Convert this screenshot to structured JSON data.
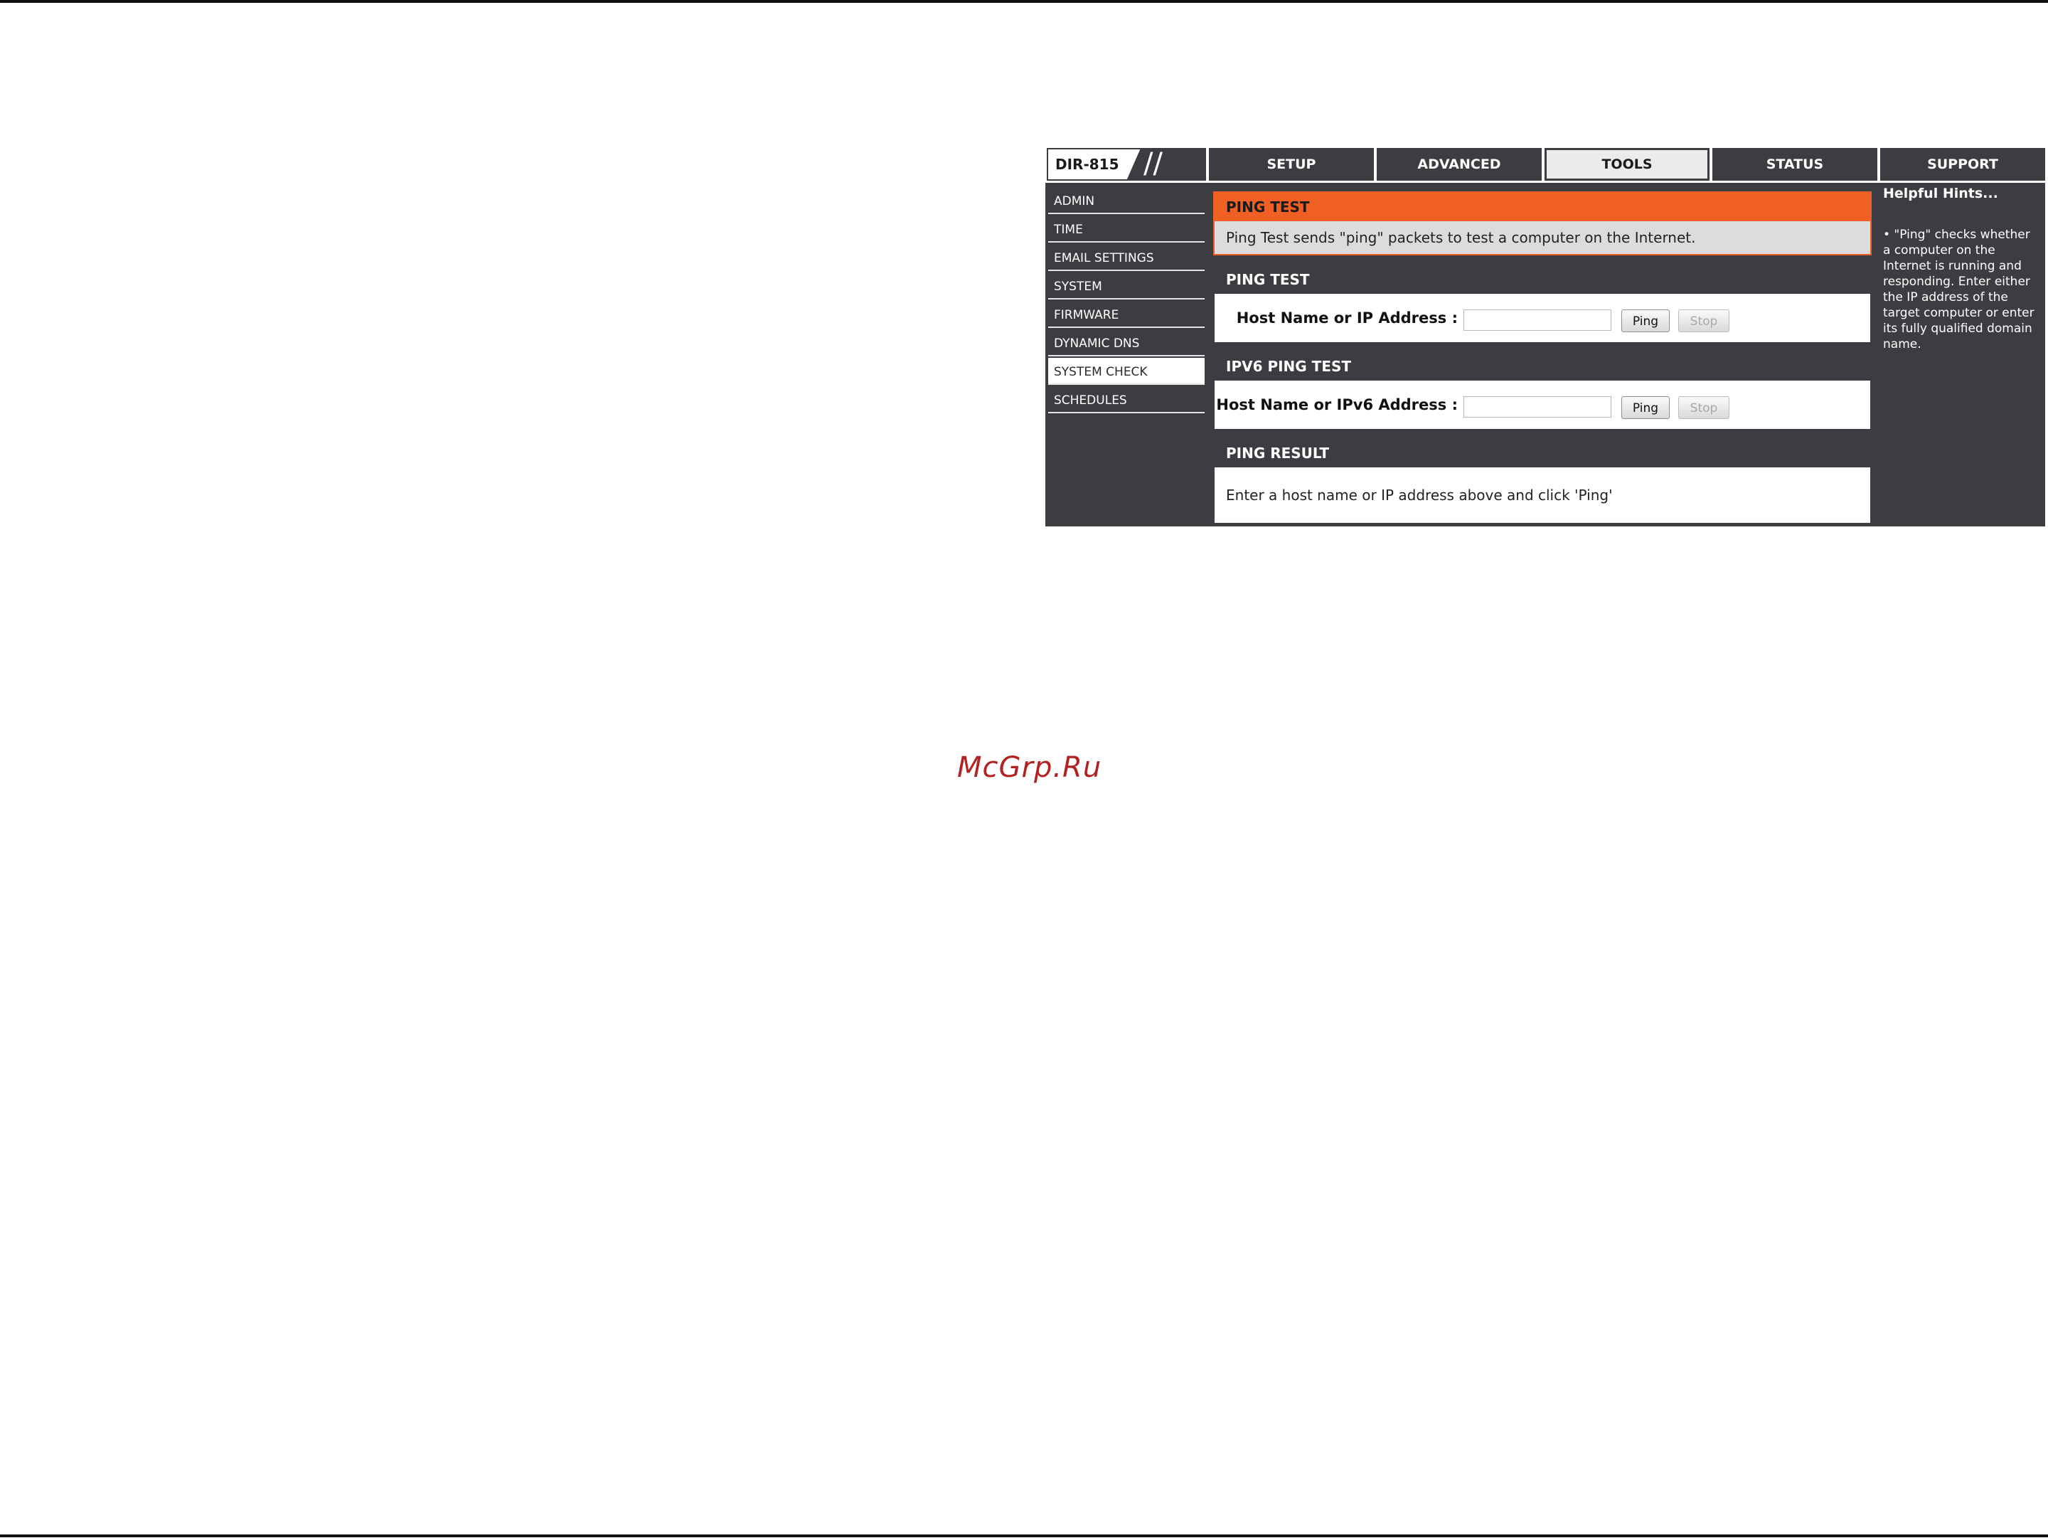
{
  "router": {
    "model": "DIR-815",
    "slashes": "//",
    "tabs": [
      {
        "label": "SETUP"
      },
      {
        "label": "ADVANCED"
      },
      {
        "label": "TOOLS"
      },
      {
        "label": "STATUS"
      },
      {
        "label": "SUPPORT"
      }
    ],
    "active_tab": "TOOLS",
    "sidebar": {
      "items": [
        {
          "label": "ADMIN"
        },
        {
          "label": "TIME"
        },
        {
          "label": "EMAIL SETTINGS"
        },
        {
          "label": "SYSTEM"
        },
        {
          "label": "FIRMWARE"
        },
        {
          "label": "DYNAMIC DNS"
        },
        {
          "label": "SYSTEM CHECK"
        },
        {
          "label": "SCHEDULES"
        }
      ],
      "active_item": "SYSTEM CHECK"
    },
    "intro": {
      "title": "PING TEST",
      "text": "Ping Test sends \"ping\" packets to test a computer on the Internet."
    },
    "ping_test": {
      "title": "PING TEST",
      "label": "Host Name or IP Address :",
      "value": "",
      "ping_label": "Ping",
      "stop_label": "Stop"
    },
    "ipv6_ping_test": {
      "title": "IPV6 PING TEST",
      "label": "Host Name or IPv6 Address :",
      "value": "",
      "ping_label": "Ping",
      "stop_label": "Stop"
    },
    "ping_result": {
      "title": "PING RESULT",
      "text": "Enter a host name or IP address above and click 'Ping'"
    },
    "hints": {
      "title": "Helpful Hints...",
      "text": "• \"Ping\" checks whether a computer on the Internet is running and responding. Enter either the IP address of the target computer or enter its fully qualified domain name."
    },
    "colors": {
      "chrome": "#3c3d41",
      "accent": "#f05f24",
      "intro_body": "#dcdcdc"
    }
  },
  "watermark": "McGrp.Ru"
}
